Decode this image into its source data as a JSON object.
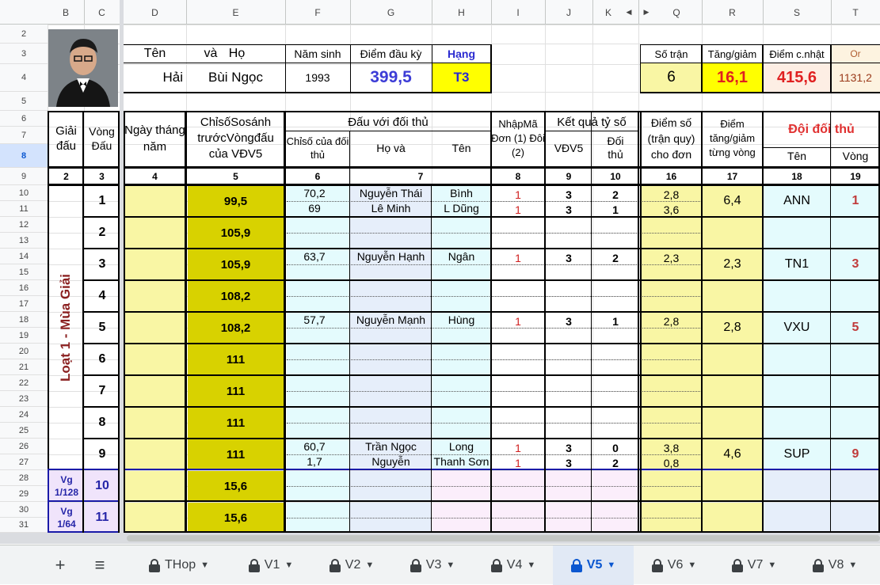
{
  "columns": {
    "B": "B",
    "C": "C",
    "D": "D",
    "E": "E",
    "F": "F",
    "G": "G",
    "H": "H",
    "I": "I",
    "J": "J",
    "K": "K",
    "Q": "Q",
    "R": "R",
    "S": "S",
    "T": "T"
  },
  "rows": [
    "2",
    "3",
    "4",
    "5",
    "6",
    "7",
    "8",
    "9",
    "10",
    "11",
    "12",
    "13",
    "14",
    "15",
    "16",
    "17",
    "18",
    "19",
    "20",
    "21",
    "22",
    "23",
    "24",
    "25",
    "26",
    "27",
    "28",
    "29",
    "30",
    "31"
  ],
  "header": {
    "ten_label": "Tên",
    "va_label": "và",
    "ho_label": "Họ",
    "ten_value": "Hải",
    "ho_value": "Bùi Ngọc",
    "nam_sinh_label": "Năm sinh",
    "nam_sinh_value": "1993",
    "diem_dau_ky_label": "Điểm đầu kỳ",
    "diem_dau_ky_value": "399,5",
    "hang_label": "Hạng",
    "hang_value": "T3",
    "so_tran_label": "Số trận",
    "so_tran_value": "6",
    "tang_giam_label": "Tăng/giảm",
    "tang_giam_value": "16,1",
    "diem_cnhat_label": "Điểm c.nhật",
    "diem_cnhat_value": "415,6",
    "or_label": "Or",
    "or_value": "1131,2"
  },
  "table_head": {
    "giai_dau": "Giải đấu",
    "vong_dau": "Vòng Đấu",
    "ngay": "Ngày tháng năm",
    "chiso_ss": "ChỉsốSosánh trướcVòngđấu của VĐV5",
    "dau_voi": "Đấu với đối thủ",
    "chiso_dt": "Chỉsố của đối thủ",
    "ho_va": "Họ và",
    "ten": "Tên",
    "nhapma": "NhậpMã Đơn (1) Đôi (2)",
    "ket_qua": "Kết quả tỷ số",
    "vdv5": "VĐV5",
    "doi_thu": "Đối thủ",
    "diem_so": "Điểm số (trận quy) cho đơn",
    "diem_tg": "Điểm tăng/giảm từng vòng",
    "doi_doi_thu": "Đội đối thủ",
    "ten_doi": "Tên",
    "vong": "Vòng"
  },
  "col_numbers": [
    "2",
    "3",
    "4",
    "5",
    "6",
    "7",
    "8",
    "9",
    "10",
    "16",
    "17",
    "18",
    "19"
  ],
  "section_label": "Loạt 1 - Mùa Giải",
  "rounds": [
    {
      "vong": "1",
      "chiso": "99,5",
      "diem_tg": "6,4",
      "team": "ANN",
      "team_vong": "1",
      "opp": [
        {
          "chiso": "70,2",
          "ho": "Nguyễn Thái",
          "ten": "Bình",
          "ma": "1",
          "vdv5": "3",
          "dt": "2",
          "diem": "2,8"
        },
        {
          "chiso": "69",
          "ho": "Lê Minh",
          "ten": "L Dũng",
          "ma": "1",
          "vdv5": "3",
          "dt": "1",
          "diem": "3,6"
        }
      ]
    },
    {
      "vong": "2",
      "chiso": "105,9",
      "diem_tg": "",
      "team": "",
      "team_vong": "",
      "opp": []
    },
    {
      "vong": "3",
      "chiso": "105,9",
      "diem_tg": "2,3",
      "team": "TN1",
      "team_vong": "3",
      "opp": [
        {
          "chiso": "63,7",
          "ho": "Nguyễn Hạnh",
          "ten": "Ngân",
          "ma": "1",
          "vdv5": "3",
          "dt": "2",
          "diem": "2,3"
        }
      ]
    },
    {
      "vong": "4",
      "chiso": "108,2",
      "diem_tg": "",
      "team": "",
      "team_vong": "",
      "opp": []
    },
    {
      "vong": "5",
      "chiso": "108,2",
      "diem_tg": "2,8",
      "team": "VXU",
      "team_vong": "5",
      "opp": [
        {
          "chiso": "57,7",
          "ho": "Nguyễn Mạnh",
          "ten": "Hùng",
          "ma": "1",
          "vdv5": "3",
          "dt": "1",
          "diem": "2,8"
        }
      ]
    },
    {
      "vong": "6",
      "chiso": "111",
      "diem_tg": "",
      "team": "",
      "team_vong": "",
      "opp": []
    },
    {
      "vong": "7",
      "chiso": "111",
      "diem_tg": "",
      "team": "",
      "team_vong": "",
      "opp": []
    },
    {
      "vong": "8",
      "chiso": "111",
      "diem_tg": "",
      "team": "",
      "team_vong": "",
      "opp": []
    },
    {
      "vong": "9",
      "chiso": "111",
      "diem_tg": "4,6",
      "team": "SUP",
      "team_vong": "9",
      "opp": [
        {
          "chiso": "60,7",
          "ho": "Trần Ngọc",
          "ten": "Long",
          "ma": "1",
          "vdv5": "3",
          "dt": "0",
          "diem": "3,8"
        },
        {
          "chiso": "1,7",
          "ho": "Nguyễn",
          "ten": "Thanh Sơn",
          "ma": "1",
          "vdv5": "3",
          "dt": "2",
          "diem": "0,8"
        }
      ]
    }
  ],
  "vg_rounds": [
    {
      "label1": "Vg",
      "label2": "1/128",
      "vong": "10",
      "chiso": "15,6"
    },
    {
      "label1": "Vg",
      "label2": "1/64",
      "vong": "11",
      "chiso": "15,6"
    }
  ],
  "tabs": {
    "add": "+",
    "menu": "≡",
    "sheets": [
      "THop",
      "V1",
      "V2",
      "V3",
      "V4",
      "V5",
      "V6",
      "V7",
      "V8"
    ],
    "active": "V5"
  },
  "icons": {
    "lock": "lock-icon",
    "caret": "caret-down-icon",
    "photo": "player-photo"
  }
}
